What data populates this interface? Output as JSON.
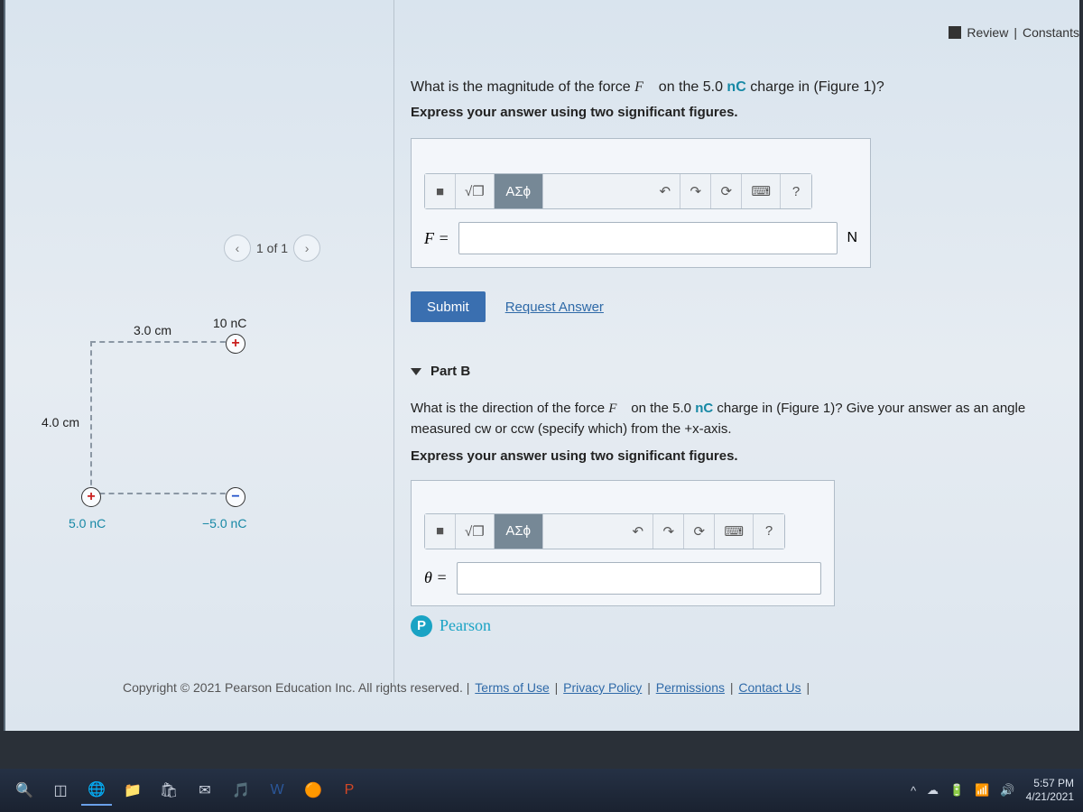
{
  "header": {
    "review": "Review",
    "constants": "Constants"
  },
  "figure": {
    "counter": "1 of 1",
    "labels": {
      "top_dist": "3.0 cm",
      "left_dist": "4.0 cm",
      "q_top": "10 nC",
      "q_bl": "5.0 nC",
      "q_br": "−5.0 nC"
    }
  },
  "partA": {
    "question_pre": "What is the magnitude of the force ",
    "force_sym": "F⃗",
    "question_mid": " on the 5.0 ",
    "nc": "nC",
    "question_post": " charge in (Figure 1)?",
    "instruct": "Express your answer using two significant figures.",
    "toolbar": {
      "template": "■",
      "fraction": "√❐",
      "greek": "ΑΣϕ",
      "undo": "↶",
      "redo": "↷",
      "reset": "⟳",
      "keyboard": "⌨",
      "help": "?"
    },
    "lhs": "F =",
    "unit": "N",
    "submit": "Submit",
    "request": "Request Answer"
  },
  "partB": {
    "title": "Part B",
    "question_pre": "What is the direction of the force ",
    "force_sym": "F⃗",
    "question_mid": " on the 5.0 ",
    "nc": "nC",
    "question_post": " charge in (Figure 1)? Give your answer as an angle measured cw or ccw (specify which) from the +x-axis.",
    "instruct": "Express your answer using two significant figures.",
    "lhs": "θ ="
  },
  "pearson": "Pearson",
  "footer": {
    "copyright": "Copyright © 2021 Pearson Education Inc. All rights reserved. | ",
    "links": {
      "terms": "Terms of Use",
      "privacy": "Privacy Policy",
      "perm": "Permissions",
      "contact": "Contact Us"
    }
  },
  "taskbar": {
    "time": "5:57 PM",
    "date": "4/21/2021"
  }
}
